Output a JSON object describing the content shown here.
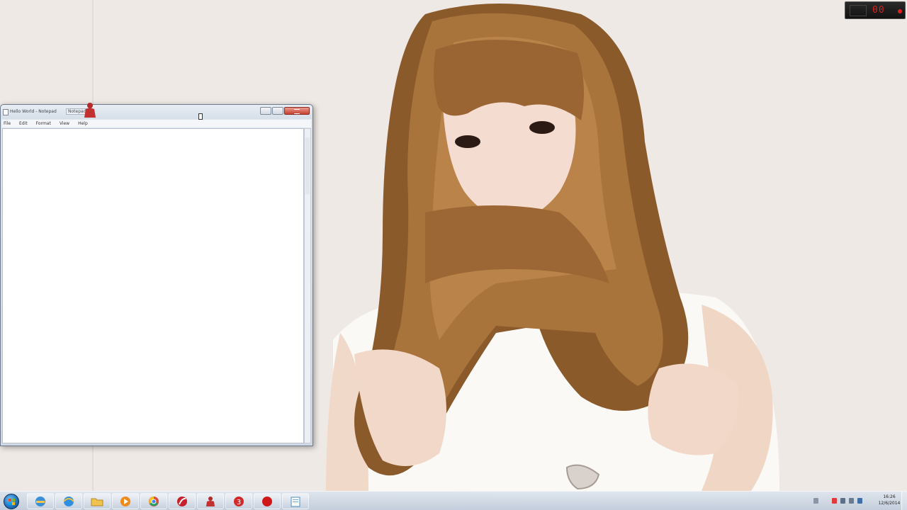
{
  "desktop": {
    "wallpaper": "woman-with-long-brown-hair-photo"
  },
  "notepad": {
    "title": "Hello World - Notepad",
    "tab_label": "Notepad",
    "menu": [
      "File",
      "Edit",
      "Format",
      "View",
      "Help"
    ],
    "content": ""
  },
  "gadget": {
    "value": "00"
  },
  "taskbar": {
    "items": [
      {
        "name": "windows-explorer",
        "icon": "explorer-icon"
      },
      {
        "name": "internet-explorer",
        "icon": "internet-explorer-icon"
      },
      {
        "name": "libraries-folder",
        "icon": "folder-icon"
      },
      {
        "name": "media-player",
        "icon": "media-player-icon"
      },
      {
        "name": "chrome",
        "icon": "chrome-icon"
      },
      {
        "name": "flash-app",
        "icon": "flash-icon"
      },
      {
        "name": "game-app",
        "icon": "red-figure-icon"
      },
      {
        "name": "red-app-3",
        "icon": "red-three-icon"
      },
      {
        "name": "record-app",
        "icon": "record-icon"
      },
      {
        "name": "notepad",
        "icon": "notepad-icon"
      }
    ],
    "clock": {
      "time": "16:26",
      "date": "12/6/2014"
    }
  },
  "colors": {
    "close_button": "#c7402f",
    "gadget_digits": "#d62020",
    "taskbar": "#c8d3e1"
  }
}
